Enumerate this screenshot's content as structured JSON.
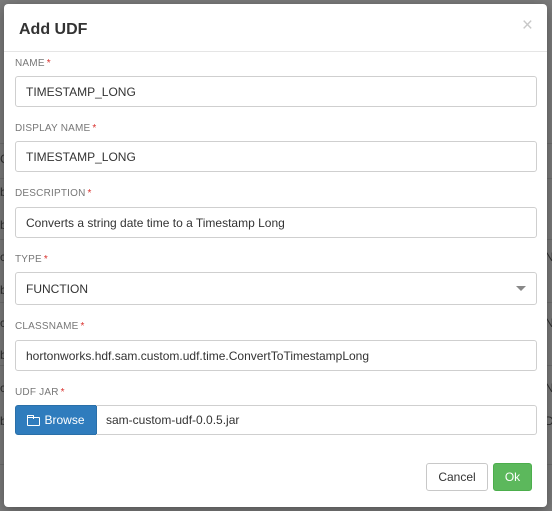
{
  "modal": {
    "title": "Add UDF",
    "close_glyph": "×",
    "required_marker": "*"
  },
  "fields": {
    "name": {
      "label": "NAME",
      "value": "TIMESTAMP_LONG"
    },
    "display_name": {
      "label": "DISPLAY NAME",
      "value": "TIMESTAMP_LONG"
    },
    "description": {
      "label": "DESCRIPTION",
      "value": "Converts a string date time to a Timestamp Long"
    },
    "type": {
      "label": "TYPE",
      "value": "FUNCTION"
    },
    "classname": {
      "label": "CLASSNAME",
      "value": "hortonworks.hdf.sam.custom.udf.time.ConvertToTimestampLong"
    },
    "udf_jar": {
      "label": "UDF JAR",
      "browse_label": "Browse",
      "file_name": "sam-custom-udf-0.0.5.jar"
    }
  },
  "footer": {
    "cancel_label": "Cancel",
    "ok_label": "Ok"
  },
  "background": {
    "glyphs": [
      "C",
      "b",
      "b",
      "c",
      "b",
      "c",
      "b",
      "c",
      "b",
      "N",
      "N",
      "N",
      "D"
    ]
  },
  "icons": {
    "close": "close-icon",
    "folder": "folder-open-icon",
    "caret": "chevron-down-icon"
  },
  "colors": {
    "primary": "#2f7cbd",
    "success": "#5cb85c",
    "required": "#d9302c"
  }
}
